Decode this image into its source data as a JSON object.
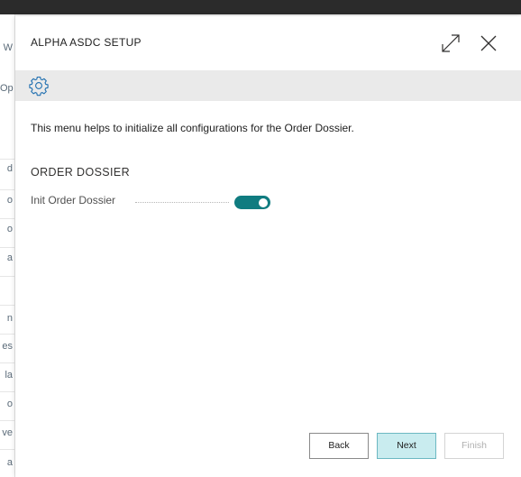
{
  "dialog": {
    "title": "ALPHA ASDC SETUP",
    "expand_icon": "expand-icon",
    "close_icon": "close-icon"
  },
  "action_bar": {
    "settings_icon": "gear-icon"
  },
  "content": {
    "intro_text": "This menu helps to initialize all configurations for the Order Dossier.",
    "section_title": "ORDER DOSSIER",
    "fields": [
      {
        "label": "Init Order Dossier",
        "type": "toggle",
        "value": true
      }
    ]
  },
  "footer": {
    "back_label": "Back",
    "next_label": "Next",
    "finish_label": "Finish"
  },
  "background_fragments": [
    "W",
    "Op",
    "d",
    "o",
    "o",
    "a",
    "n",
    "es",
    "la",
    "o",
    "ve",
    "a"
  ],
  "colors": {
    "accent": "#107c80",
    "next_button_bg": "#c9ecef",
    "action_bar_bg": "#eaeaea",
    "top_bar": "#2b2b2b"
  }
}
